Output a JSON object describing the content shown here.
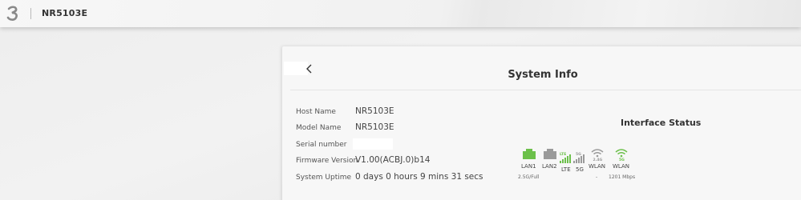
{
  "header": {
    "product_name": "NR5103E",
    "logo_icon": "three-logo-icon"
  },
  "card": {
    "title": "System Info",
    "back_icon": "chevron-left-icon"
  },
  "system_info": [
    {
      "label": "Host Name",
      "value": "NR5103E"
    },
    {
      "label": "Model Name",
      "value": "NR5103E"
    },
    {
      "label": "Serial number",
      "value": ""
    },
    {
      "label": "Firmware Version",
      "value": "V1.00(ACBJ.0)b14"
    },
    {
      "label": "System Uptime",
      "value": "0 days 0 hours 9 mins 31 secs"
    }
  ],
  "interface_status": {
    "title": "Interface Status",
    "interfaces": [
      {
        "label": "LAN1",
        "icon": "ethernet-port-icon",
        "status": "connected",
        "detail": "2.5G/Full"
      },
      {
        "label": "LAN2",
        "icon": "ethernet-port-icon",
        "status": "disconnected",
        "detail": ""
      },
      {
        "label": "LTE",
        "icon": "signal-bars-icon",
        "badge": "LTE",
        "status": "connected",
        "detail": ""
      },
      {
        "label": "5G",
        "icon": "signal-bars-icon",
        "badge": "5G",
        "status": "disconnected",
        "detail": ""
      },
      {
        "label": "WLAN",
        "icon": "wifi-icon",
        "badge": "2.4G",
        "status": "disconnected",
        "detail": "-"
      },
      {
        "label": "WLAN",
        "icon": "wifi-icon",
        "badge": "5G",
        "status": "connected",
        "detail": "1201 Mbps"
      }
    ],
    "colors": {
      "connected": "#6cc04a",
      "disconnected": "#9a9a9a"
    }
  }
}
